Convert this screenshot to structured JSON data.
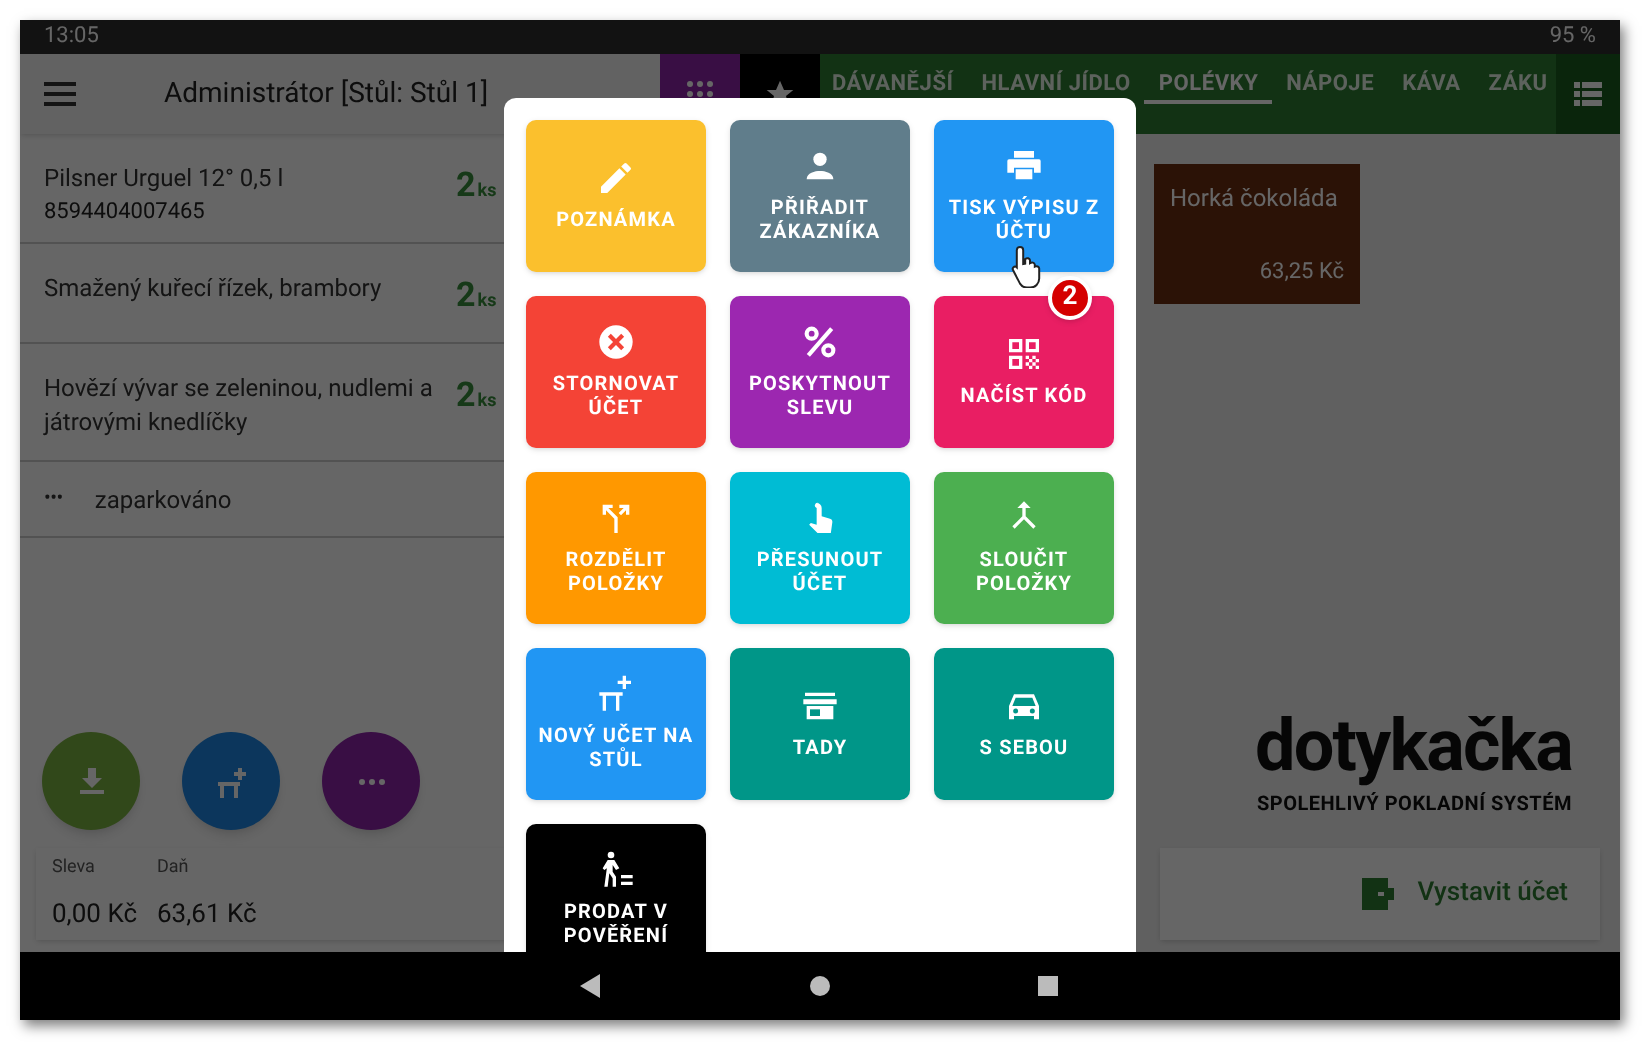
{
  "status_bar": {
    "time": "13:05",
    "battery": "95 %"
  },
  "app_bar": {
    "title": "Administrátor [Stůl: Stůl 1]"
  },
  "order_items": [
    {
      "name": "Pilsner Urguel 12° 0,5 l",
      "code": "8594404007465",
      "quantity": "2",
      "unit": "ks"
    },
    {
      "name": "Smažený kuřecí řízek, brambory",
      "quantity": "2",
      "unit": "ks"
    },
    {
      "name": "Hovězí vývar se zeleninou, nudlemi a játrovými knedlíčky",
      "quantity": "2",
      "unit": "ks"
    }
  ],
  "parked": {
    "icon": "•••",
    "label": "zaparkováno"
  },
  "summary": [
    {
      "label": "Sleva",
      "value": "0,00 Kč"
    },
    {
      "label": "Daň",
      "value": "63,61 Kč"
    }
  ],
  "category_tabs": [
    {
      "label": "DÁVANĚJŠÍ",
      "selected": false
    },
    {
      "label": "HLAVNÍ JÍDLO",
      "selected": false
    },
    {
      "label": "POLÉVKY",
      "selected": true
    },
    {
      "label": "NÁPOJE",
      "selected": false
    },
    {
      "label": "KÁVA",
      "selected": false
    },
    {
      "label": "ZÁKU",
      "selected": false
    }
  ],
  "products": [
    {
      "name": "Horká čokoláda",
      "price": "63,25 Kč"
    }
  ],
  "logo": {
    "name": "dotykačka",
    "tagline": "SPOLEHLIVÝ POKLADNÍ SYSTÉM"
  },
  "issue_button": "Vystavit účet",
  "action_menu": [
    {
      "label": "POZNÁMKA",
      "color": "#fbc02d"
    },
    {
      "label": "PŘIŘADIT ZÁKAZNÍKA",
      "color": "#607d8b"
    },
    {
      "label": "TISK VÝPISU Z ÚČTU",
      "color": "#2196f3"
    },
    {
      "label": "STORNOVAT ÚČET",
      "color": "#f44336"
    },
    {
      "label": "POSKYTNOUT SLEVU",
      "color": "#9c27b0"
    },
    {
      "label": "NAČÍST KÓD",
      "color": "#e91e63"
    },
    {
      "label": "ROZDĚLIT POLOŽKY",
      "color": "#ff9800"
    },
    {
      "label": "PŘESUNOUT ÚČET",
      "color": "#00bcd4"
    },
    {
      "label": "SLOUČIT POLOŽKY",
      "color": "#4caf50"
    },
    {
      "label": "NOVÝ UČET NA STŮL",
      "color": "#2196f3"
    },
    {
      "label": "TADY",
      "color": "#009688"
    },
    {
      "label": "S SEBOU",
      "color": "#009688"
    },
    {
      "label": "PRODAT V POVĚŘENÍ",
      "color": "#000000"
    }
  ],
  "step_badge": "2"
}
